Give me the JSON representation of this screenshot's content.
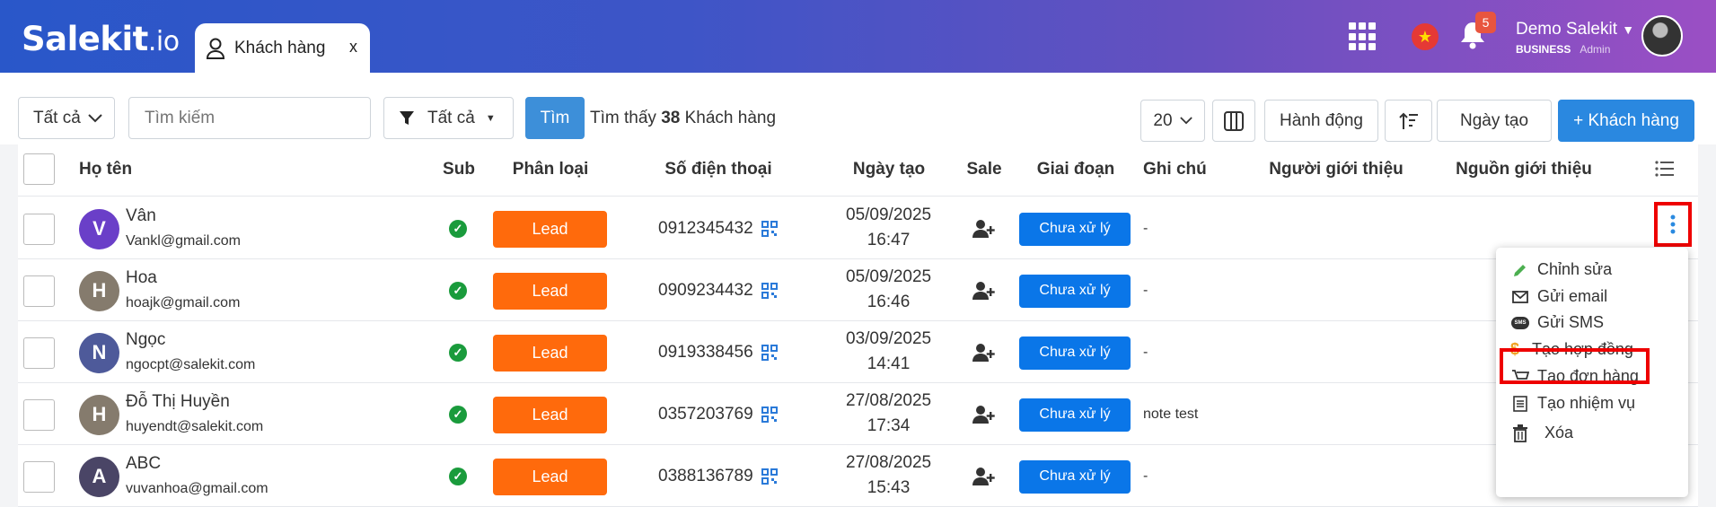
{
  "app": {
    "logo": "Salekit",
    "logo_suffix": ".io"
  },
  "tab": {
    "label": "Khách hàng",
    "close": "x"
  },
  "header": {
    "notification_count": "5",
    "user_name": "Demo Salekit",
    "user_plan": "BUSINESS",
    "user_role": "Admin",
    "flag_star": "★"
  },
  "toolbar": {
    "scope_select": "Tất cả",
    "search_placeholder": "Tìm kiếm",
    "filter_select": "Tất cả",
    "search_button": "Tìm",
    "found_prefix": "Tìm thấy",
    "found_count": "38",
    "found_suffix": "Khách hàng",
    "page_size": "20",
    "actions_button": "Hành động",
    "date_sort": "Ngày tạo",
    "add_button": "+ Khách hàng"
  },
  "columns": {
    "name": "Họ tên",
    "sub": "Sub",
    "type": "Phân loại",
    "phone": "Số điện thoại",
    "created": "Ngày tạo",
    "sale": "Sale",
    "stage": "Giai đoạn",
    "note": "Ghi chú",
    "referrer": "Người giới thiệu",
    "source": "Nguồn giới thiệu"
  },
  "rows": [
    {
      "initial": "V",
      "name": "Vân",
      "email": "Vankl@gmail.com",
      "type": "Lead",
      "phone": "0912345432",
      "date": "05/09/2025",
      "time": "16:47",
      "stage": "Chưa xử lý",
      "note": "-",
      "color": "#6a3fc8"
    },
    {
      "initial": "H",
      "name": "Hoa",
      "email": "hoajk@gmail.com",
      "type": "Lead",
      "phone": "0909234432",
      "date": "05/09/2025",
      "time": "16:46",
      "stage": "Chưa xử lý",
      "note": "-",
      "color": "#857b6d"
    },
    {
      "initial": "N",
      "name": "Ngọc",
      "email": "ngocpt@salekit.com",
      "type": "Lead",
      "phone": "0919338456",
      "date": "03/09/2025",
      "time": "14:41",
      "stage": "Chưa xử lý",
      "note": "-",
      "color": "#4e5a9a"
    },
    {
      "initial": "H",
      "name": "Đỗ Thị Huyền",
      "email": "huyendt@salekit.com",
      "type": "Lead",
      "phone": "0357203769",
      "date": "27/08/2025",
      "time": "17:34",
      "stage": "Chưa xử lý",
      "note": "note test",
      "color": "#857b6d"
    },
    {
      "initial": "A",
      "name": "ABC",
      "email": "vuvanhoa@gmail.com",
      "type": "Lead",
      "phone": "0388136789",
      "date": "27/08/2025",
      "time": "15:43",
      "stage": "Chưa xử lý",
      "note": "-",
      "color": "#4a4566"
    }
  ],
  "row_menu": {
    "edit": "Chỉnh sửa",
    "email": "Gửi email",
    "sms": "Gửi SMS",
    "contract": "Tạo hợp đồng",
    "order": "Tạo đơn hàng",
    "task": "Tạo nhiệm vụ",
    "delete": "Xóa",
    "sms_icon_text": "SMS",
    "contract_icon_text": "$"
  }
}
